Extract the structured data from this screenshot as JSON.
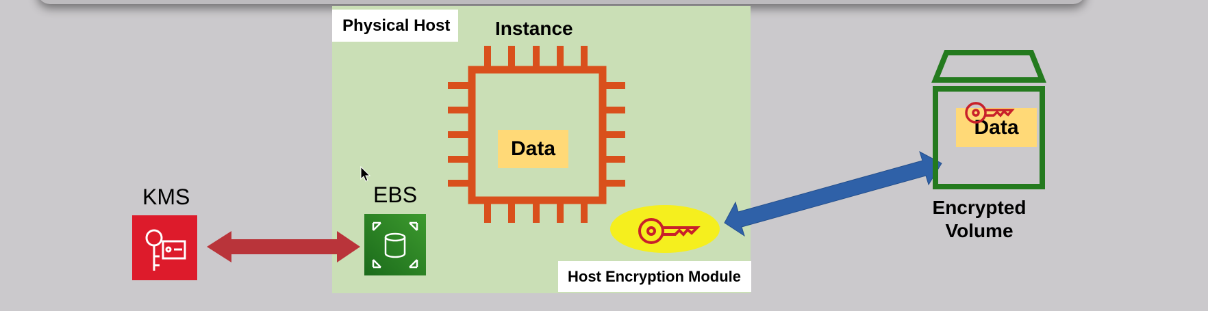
{
  "diagram": {
    "physical_host_label": "Physical Host",
    "instance_label": "Instance",
    "instance_data": "Data",
    "kms_label": "KMS",
    "ebs_label": "EBS",
    "host_encryption_module_label": "Host Encryption Module",
    "volume_data": "Data",
    "encrypted_volume_label": "Encrypted Volume"
  },
  "colors": {
    "background": "#cbc9cc",
    "host_area": "#cadfb6",
    "chip": "#d9501c",
    "data_fill": "#ffd977",
    "kms_red": "#dd1b2b",
    "ebs_green": "#1f7a1f",
    "arrow_red": "#b9343a",
    "arrow_blue": "#2f61a8",
    "key_highlight": "#f5ef1e",
    "key_red": "#c8202a",
    "volume_green": "#247a1e"
  },
  "icons": [
    "chip-icon",
    "kms-key-icon",
    "ebs-volume-icon",
    "key-icon",
    "box-icon",
    "mouse-cursor-icon"
  ]
}
